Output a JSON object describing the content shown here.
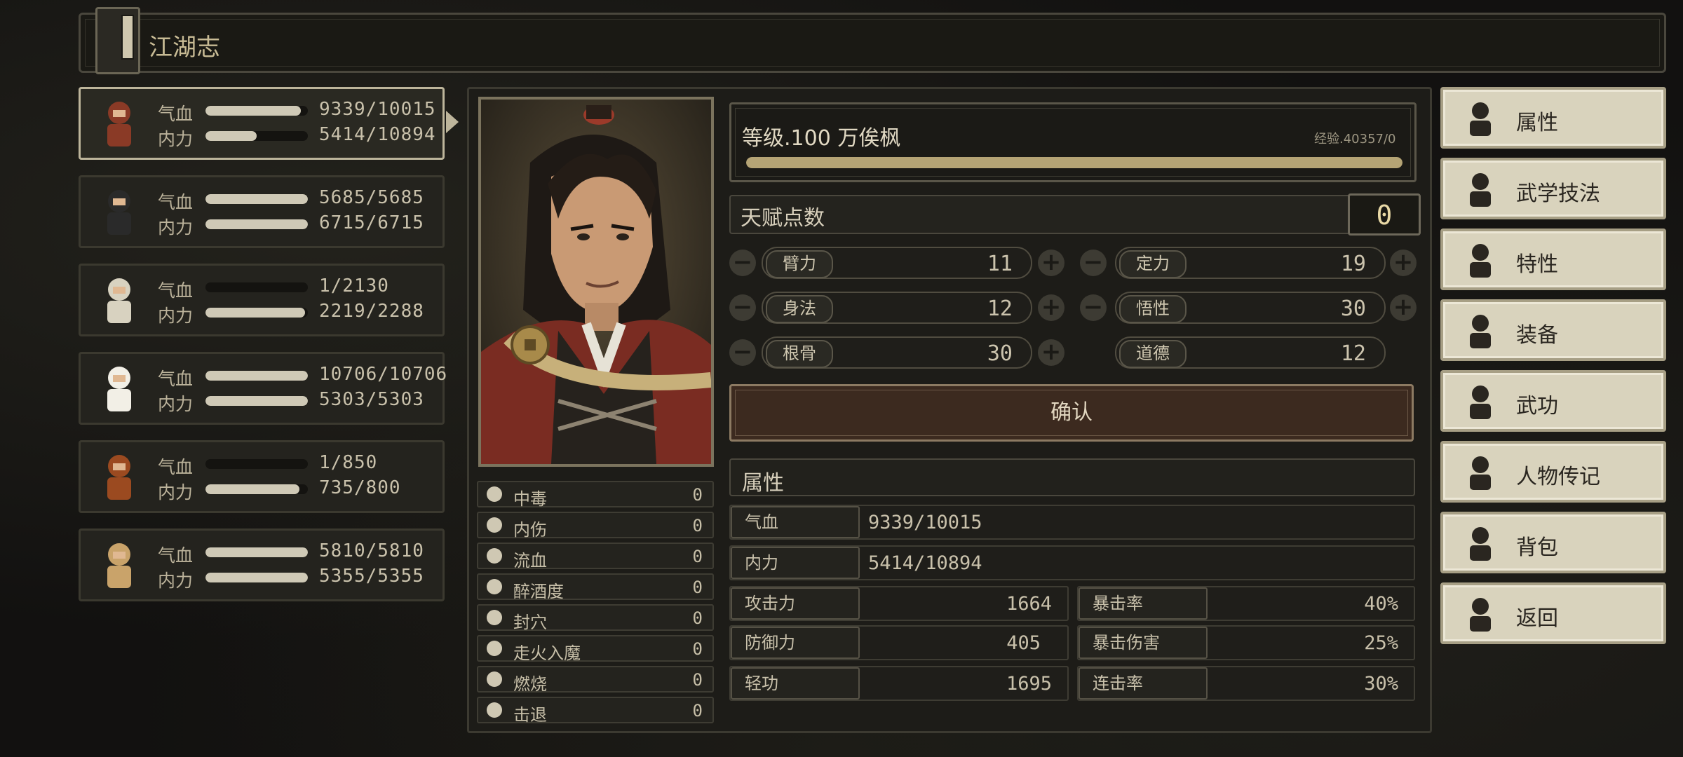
{
  "header": {
    "title": "江湖志"
  },
  "party": [
    {
      "hp_label": "气血",
      "mp_label": "内力",
      "hp": "9339/10015",
      "mp": "5414/10894",
      "hp_fill": 0.93,
      "mp_fill": 0.5,
      "selected": true
    },
    {
      "hp_label": "气血",
      "mp_label": "内力",
      "hp": "5685/5685",
      "mp": "6715/6715",
      "hp_fill": 1.0,
      "mp_fill": 1.0
    },
    {
      "hp_label": "气血",
      "mp_label": "内力",
      "hp": "1/2130",
      "mp": "2219/2288",
      "hp_fill": 0.0,
      "mp_fill": 0.97
    },
    {
      "hp_label": "气血",
      "mp_label": "内力",
      "hp": "10706/10706",
      "mp": "5303/5303",
      "hp_fill": 1.0,
      "mp_fill": 1.0
    },
    {
      "hp_label": "气血",
      "mp_label": "内力",
      "hp": "1/850",
      "mp": "735/800",
      "hp_fill": 0.0,
      "mp_fill": 0.92
    },
    {
      "hp_label": "气血",
      "mp_label": "内力",
      "hp": "5810/5810",
      "mp": "5355/5355",
      "hp_fill": 1.0,
      "mp_fill": 1.0
    }
  ],
  "status_effects": [
    {
      "name": "中毒",
      "value": "0",
      "icon": "skull-icon"
    },
    {
      "name": "内伤",
      "value": "0",
      "icon": "broken-heart-icon"
    },
    {
      "name": "流血",
      "value": "0",
      "icon": "blood-splat-icon"
    },
    {
      "name": "醉酒度",
      "value": "0",
      "icon": "drunk-face-icon"
    },
    {
      "name": "封穴",
      "value": "0",
      "icon": "sealed-meridian-icon"
    },
    {
      "name": "走火入魔",
      "value": "0",
      "icon": "possessed-icon"
    },
    {
      "name": "燃烧",
      "value": "0",
      "icon": "flame-icon"
    },
    {
      "name": "击退",
      "value": "0",
      "icon": "boot-icon"
    }
  ],
  "level": {
    "label": "等级.100 万俟枫",
    "exp": "经验.40357/0",
    "exp_fill": 1.0
  },
  "talent": {
    "label": "天赋点数",
    "value": "0"
  },
  "attributes": {
    "arm": {
      "label": "臂力",
      "value": "11"
    },
    "focus": {
      "label": "定力",
      "value": "19"
    },
    "agility": {
      "label": "身法",
      "value": "12"
    },
    "insight": {
      "label": "悟性",
      "value": "30"
    },
    "bone": {
      "label": "根骨",
      "value": "30"
    },
    "morality": {
      "label": "道德",
      "value": "12"
    }
  },
  "confirm_label": "确认",
  "stats": {
    "section_title": "属性",
    "hp": {
      "label": "气血",
      "value": "9339/10015"
    },
    "mp": {
      "label": "内力",
      "value": "5414/10894"
    },
    "attack": {
      "label": "攻击力",
      "value": "1664"
    },
    "crit_rate": {
      "label": "暴击率",
      "value": "40%"
    },
    "defense": {
      "label": "防御力",
      "value": "405"
    },
    "crit_dmg": {
      "label": "暴击伤害",
      "value": "25%"
    },
    "lightness": {
      "label": "轻功",
      "value": "1695"
    },
    "combo": {
      "label": "连击率",
      "value": "30%"
    }
  },
  "menu": [
    {
      "label": "属性",
      "icon": "character-icon"
    },
    {
      "label": "武学技法",
      "icon": "martial-skill-icon"
    },
    {
      "label": "特性",
      "icon": "trait-icon"
    },
    {
      "label": "装备",
      "icon": "sword-icon"
    },
    {
      "label": "武功",
      "icon": "manual-book-icon"
    },
    {
      "label": "人物传记",
      "icon": "biography-icon"
    },
    {
      "label": "背包",
      "icon": "bag-icon"
    },
    {
      "label": "返回",
      "icon": "door-icon"
    }
  ],
  "colors": {
    "accent_gold": "#b5a475",
    "menu_bg": "#d9d3bd",
    "bar_fill": "#cfc9b6",
    "confirm_bg": "#3c2a1f"
  }
}
